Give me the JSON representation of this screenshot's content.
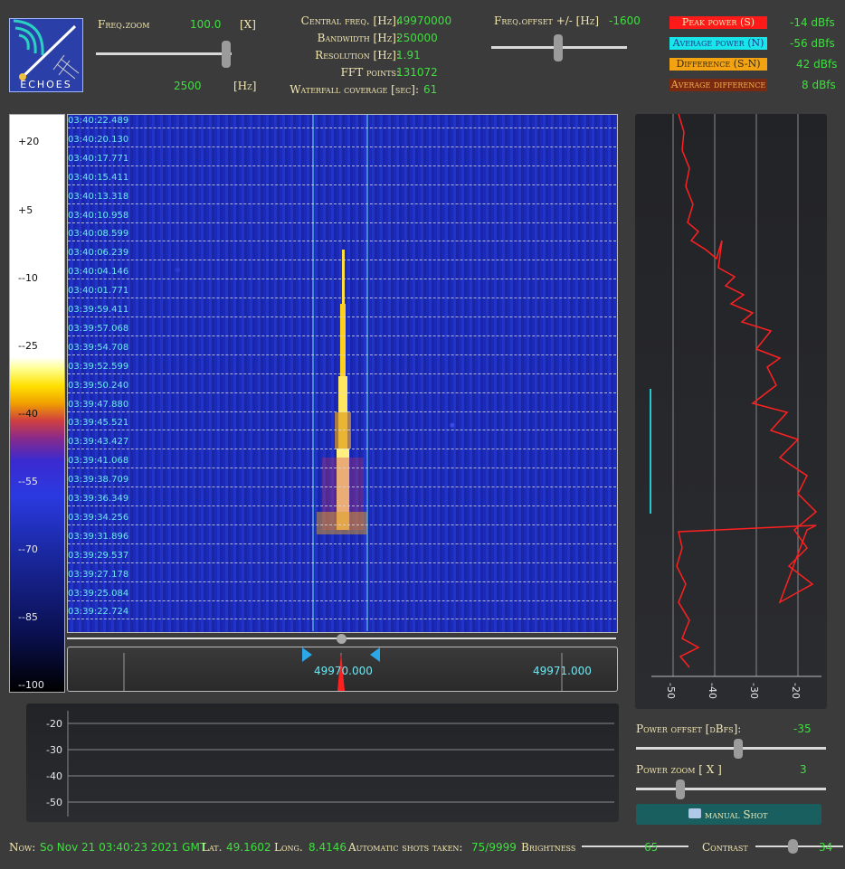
{
  "logo": {
    "text": "ECHOES"
  },
  "header": {
    "freq_zoom_label": "Freq.zoom",
    "freq_zoom_value": "100.0",
    "freq_zoom_unit": "[X]",
    "freq_zoom_hz": "2500",
    "freq_zoom_hz_unit": "[Hz]",
    "info": [
      {
        "label": "Central freq. [Hz]:",
        "value": "49970000"
      },
      {
        "label": "Bandwidth  [Hz]:",
        "value": "250000"
      },
      {
        "label": "Resolution [Hz]:",
        "value": "1.91"
      },
      {
        "label": "FFT points:",
        "value": "131072"
      },
      {
        "label": "Waterfall coverage [sec]:",
        "value": "61"
      }
    ],
    "freq_offset_label": "Freq.offset +/- [Hz]",
    "freq_offset_value": "-1600",
    "legend": [
      {
        "label": "Peak power (S)",
        "value": "-14 dBfs",
        "bg": "#ff1a1a",
        "fg": "#f7e8b6"
      },
      {
        "label": "Average power (N)",
        "value": "-56 dBfs",
        "bg": "#19e6ea",
        "fg": "#1a3a8a"
      },
      {
        "label": "Difference (S-N)",
        "value": "42 dBfs",
        "bg": "#f3a312",
        "fg": "#3a2a10"
      },
      {
        "label": "Average difference",
        "value": "8 dBfs",
        "bg": "#7a2a10",
        "fg": "#f0b050"
      }
    ]
  },
  "colorbar": {
    "ticks": [
      "+20",
      "+5",
      "--10",
      "--25",
      "--40",
      "--55",
      "--70",
      "--85",
      "--100"
    ]
  },
  "waterfall": {
    "timestamps": [
      "03:40:22.489",
      "03:40:20.130",
      "03:40:17.771",
      "03:40:15.411",
      "03:40:13.318",
      "03:40:10.958",
      "03:40:08.599",
      "03:40:06.239",
      "03:40:04.146",
      "03:40:01.771",
      "03:39:59.411",
      "03:39:57.068",
      "03:39:54.708",
      "03:39:52.599",
      "03:39:50.240",
      "03:39:47.880",
      "03:39:45.521",
      "03:39:43.427",
      "03:39:41.068",
      "03:39:38.709",
      "03:39:36.349",
      "03:39:34.256",
      "03:39:31.896",
      "03:39:29.537",
      "03:39:27.178",
      "03:39:25.084",
      "03:39:22.724"
    ],
    "freq_labels": [
      "49970.000",
      "49971.000"
    ]
  },
  "power_plot": {
    "axis_labels": [
      "-50",
      "-40",
      "-30",
      "-20"
    ]
  },
  "bottom_plot": {
    "axis_labels": [
      "-20",
      "-30",
      "-40",
      "-50"
    ]
  },
  "controls": {
    "power_offset_label": "Power offset [dBfs]:",
    "power_offset_value": "-35",
    "power_zoom_label": "Power zoom  [ X ]",
    "power_zoom_value": "3",
    "manual_shot_label": "manual Shot"
  },
  "status": {
    "now_label": "Now:",
    "now_value": "So Nov 21 03:40:23 2021 GMT",
    "lat_label": "Lat.",
    "lat_value": "49.1602",
    "long_label": "Long.",
    "long_value": "8.4146",
    "shots_label": "Automatic shots taken:",
    "shots_value": "75/9999",
    "brightness_label": "Brightness",
    "brightness_value": "65",
    "contrast_label": "Contrast",
    "contrast_value": "34"
  }
}
